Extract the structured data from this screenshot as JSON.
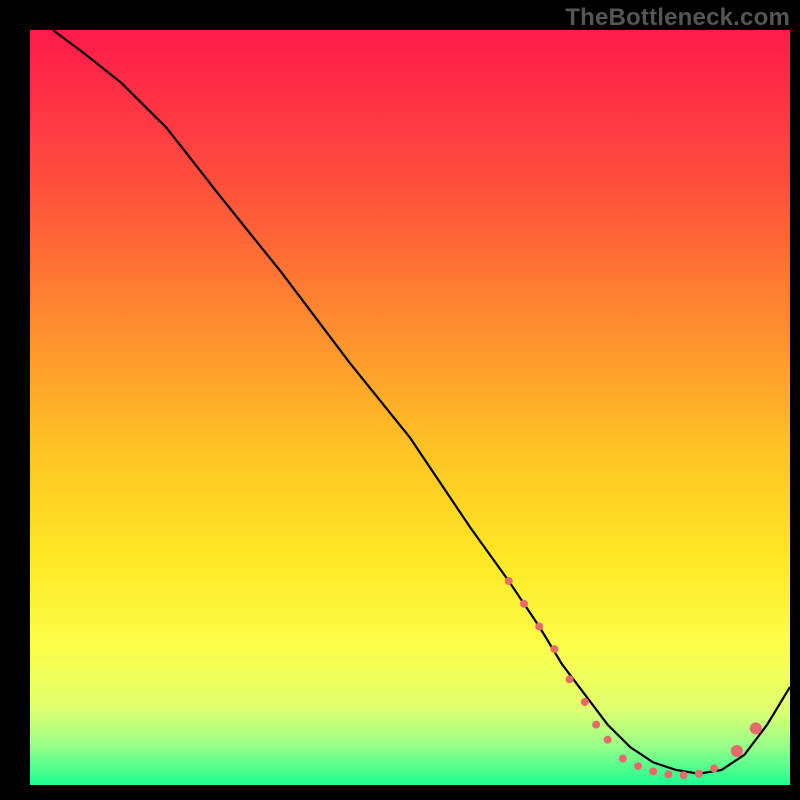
{
  "watermark": "TheBottleneck.com",
  "chart_data": {
    "type": "line",
    "title": "",
    "xlabel": "",
    "ylabel": "",
    "xlim": [
      0,
      100
    ],
    "ylim": [
      0,
      100
    ],
    "legend": false,
    "grid": false,
    "background_gradient": {
      "stops": [
        {
          "offset": 0.0,
          "color": "#ff1a4b"
        },
        {
          "offset": 0.2,
          "color": "#ff4d3c"
        },
        {
          "offset": 0.4,
          "color": "#ff8f2e"
        },
        {
          "offset": 0.55,
          "color": "#ffc224"
        },
        {
          "offset": 0.7,
          "color": "#ffe824"
        },
        {
          "offset": 0.82,
          "color": "#fbff4a"
        },
        {
          "offset": 0.9,
          "color": "#dfff70"
        },
        {
          "offset": 0.95,
          "color": "#95ff8a"
        },
        {
          "offset": 1.0,
          "color": "#1aff90"
        }
      ]
    },
    "series": [
      {
        "name": "curve",
        "color": "#000000",
        "x": [
          3,
          7,
          12,
          18,
          25,
          33,
          42,
          50,
          58,
          63,
          67,
          70,
          73,
          76,
          79,
          82,
          85,
          88,
          91,
          94,
          97,
          100
        ],
        "y": [
          100,
          97,
          93,
          87,
          78,
          68,
          56,
          46,
          34,
          27,
          21,
          16,
          12,
          8,
          5,
          3,
          2,
          1.5,
          2,
          4,
          8,
          13
        ]
      }
    ],
    "markers": {
      "name": "dots",
      "color": "#e66a6a",
      "radius_small": 4,
      "radius_large": 6,
      "points": [
        {
          "x": 63,
          "y": 27,
          "r": "small"
        },
        {
          "x": 65,
          "y": 24,
          "r": "small"
        },
        {
          "x": 67,
          "y": 21,
          "r": "small"
        },
        {
          "x": 69,
          "y": 18,
          "r": "small"
        },
        {
          "x": 71,
          "y": 14,
          "r": "small"
        },
        {
          "x": 73,
          "y": 11,
          "r": "small"
        },
        {
          "x": 74.5,
          "y": 8,
          "r": "small"
        },
        {
          "x": 76,
          "y": 6,
          "r": "small"
        },
        {
          "x": 78,
          "y": 3.5,
          "r": "small"
        },
        {
          "x": 80,
          "y": 2.5,
          "r": "small"
        },
        {
          "x": 82,
          "y": 1.8,
          "r": "small"
        },
        {
          "x": 84,
          "y": 1.4,
          "r": "small"
        },
        {
          "x": 86,
          "y": 1.3,
          "r": "small"
        },
        {
          "x": 88,
          "y": 1.5,
          "r": "small"
        },
        {
          "x": 90,
          "y": 2.2,
          "r": "small"
        },
        {
          "x": 93,
          "y": 4.5,
          "r": "large"
        },
        {
          "x": 95.5,
          "y": 7.5,
          "r": "large"
        }
      ]
    }
  }
}
